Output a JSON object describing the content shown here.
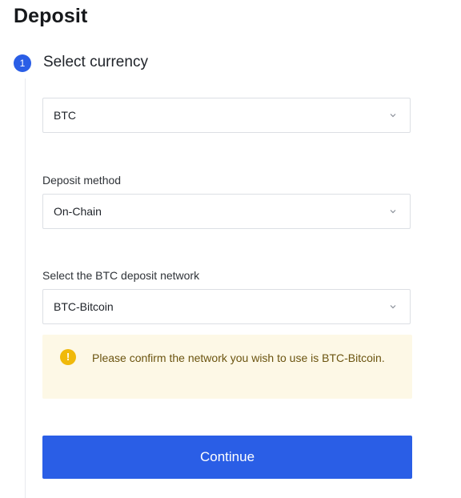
{
  "page": {
    "title": "Deposit"
  },
  "step": {
    "number": "1",
    "label": "Select currency"
  },
  "currency": {
    "value": "BTC"
  },
  "deposit_method": {
    "label": "Deposit method",
    "value": "On-Chain"
  },
  "network": {
    "label": "Select the BTC deposit network",
    "value": "BTC-Bitcoin"
  },
  "notice": {
    "icon": "warning-icon",
    "text": "Please confirm the network you wish to use is BTC-Bitcoin."
  },
  "actions": {
    "continue_label": "Continue"
  },
  "colors": {
    "primary": "#2a5ee6",
    "warning": "#f0b90b",
    "notice_bg": "#fdf8e6"
  }
}
